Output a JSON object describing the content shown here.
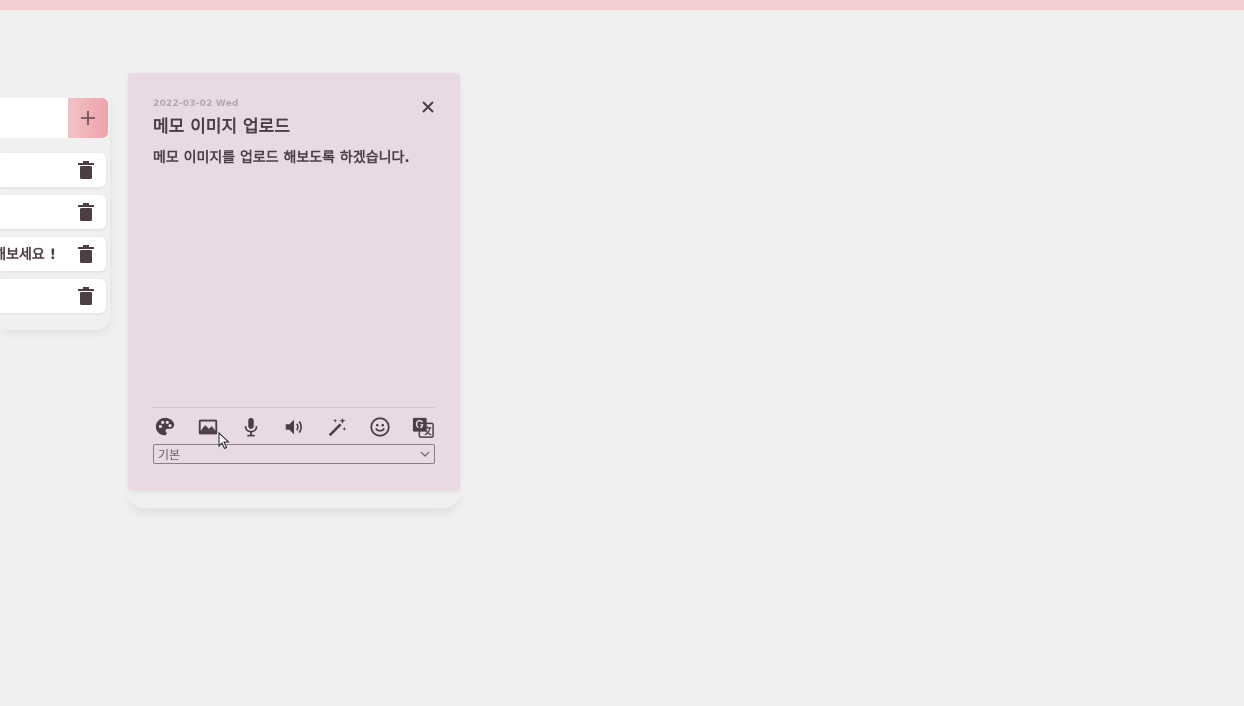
{
  "app": {
    "accent": "#eda3a8",
    "topbar_color": "#f3cfd2",
    "card_color": "#e8d9e5"
  },
  "memo_list": {
    "new_memo": {
      "value": "",
      "placeholder": ""
    },
    "add_icon": "plus-icon",
    "rows": [
      {
        "text": ""
      },
      {
        "text": ""
      },
      {
        "text": "해보세요 !"
      },
      {
        "text": ""
      }
    ],
    "delete_icon": "trash-icon"
  },
  "memo": {
    "date": "2022-03-02 Wed",
    "title": "메모 이미지 업로드",
    "body": "메모 이미지를 업로드 해보도록 하겠습니다.",
    "close_icon": "close-icon",
    "toolbar": [
      "palette-icon",
      "image-icon",
      "microphone-icon",
      "speaker-icon",
      "magic-wand-icon",
      "smile-icon",
      "translate-icon"
    ],
    "font_select": {
      "value": "기본"
    }
  }
}
